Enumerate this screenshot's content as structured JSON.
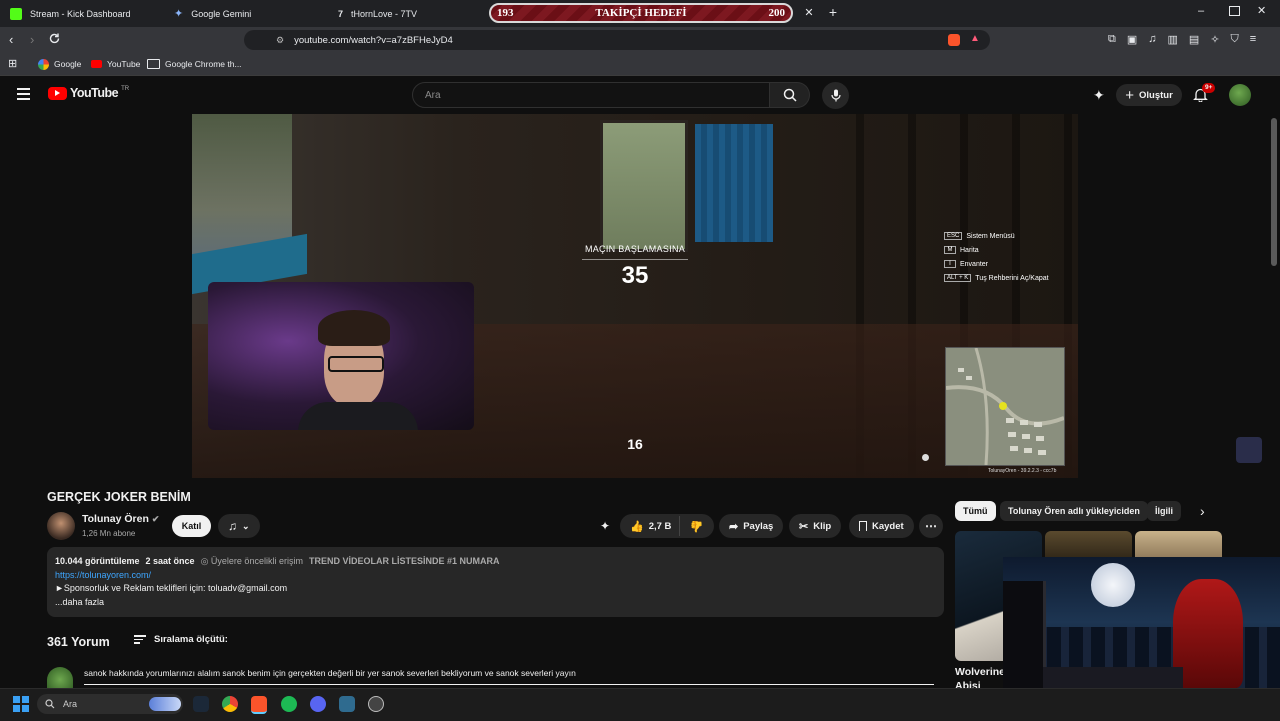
{
  "browser": {
    "tabs": [
      {
        "label": "Stream - Kick Dashboard",
        "color": "#53fc18"
      },
      {
        "label": "Google Gemini",
        "color": "#8ab4f8"
      },
      {
        "label": "tHornLove - 7TV",
        "color": "#e8eaed"
      }
    ],
    "follower_goal": {
      "current": "193",
      "label": "TAKİPÇİ HEDEFİ",
      "target": "200"
    },
    "url": "youtube.com/watch?v=a7zBFHeJyD4",
    "bookmarks": [
      "Google",
      "YouTube",
      "Google Chrome th..."
    ]
  },
  "youtube": {
    "logo_text": "YouTube",
    "region": "TR",
    "search_placeholder": "Ara",
    "create_label": "Oluştur",
    "notification_badge": "9+"
  },
  "video": {
    "hud_title": "MAÇIN BAŞLAMASINA",
    "countdown": "35",
    "players_alive": "16",
    "keys": [
      {
        "key": "ESC",
        "label": "Sistem Menüsü"
      },
      {
        "key": "M",
        "label": "Harita"
      },
      {
        "key": "I",
        "label": "Envanter"
      },
      {
        "key": "ALT + K",
        "label": "Tuş Rehberini Aç/Kapat"
      }
    ],
    "minimap_caption": "TolunayOren - 39.2.2.3 - ccc7b"
  },
  "watch": {
    "title": "GERÇEK JOKER BENİM",
    "channel": "Tolunay Ören",
    "subscribers": "1,26 Mn abone",
    "join_label": "Katıl",
    "likes": "2,7 B",
    "share_label": "Paylaş",
    "clip_label": "Klip",
    "save_label": "Kaydet"
  },
  "description": {
    "views": "10.044 görüntüleme",
    "age": "2 saat önce",
    "members_access": "Üyelere öncelikli erişim",
    "trending": "TREND VİDEOLAR LİSTESİNDE #1 NUMARA",
    "link": "https://tolunayoren.com/",
    "sponsor_line": "►Sponsorluk ve Reklam teklifleri için: toluadv@gmail.com",
    "more": "...daha fazla"
  },
  "comments": {
    "count_label": "361 Yorum",
    "sort_label": "Sıralama ölçütü:",
    "draft": "sanok hakkında yorumlarınızı alalım sanok benim için gerçekten değerli bir yer sanok severleri bekliyorum ve sanok severleri yayın"
  },
  "sidebar": {
    "chips": [
      "Tümü",
      "Tolunay Ören adlı yükleyiciden",
      "İlgili"
    ],
    "recommended_title": "Wolverine",
    "recommended_subtitle": "Abisi"
  },
  "taskbar": {
    "search_placeholder": "Ara"
  },
  "colors": {
    "yt_red": "#ff0000",
    "background": "#0f0f0f",
    "chip_bg": "#272727",
    "link": "#3ea6ff"
  }
}
